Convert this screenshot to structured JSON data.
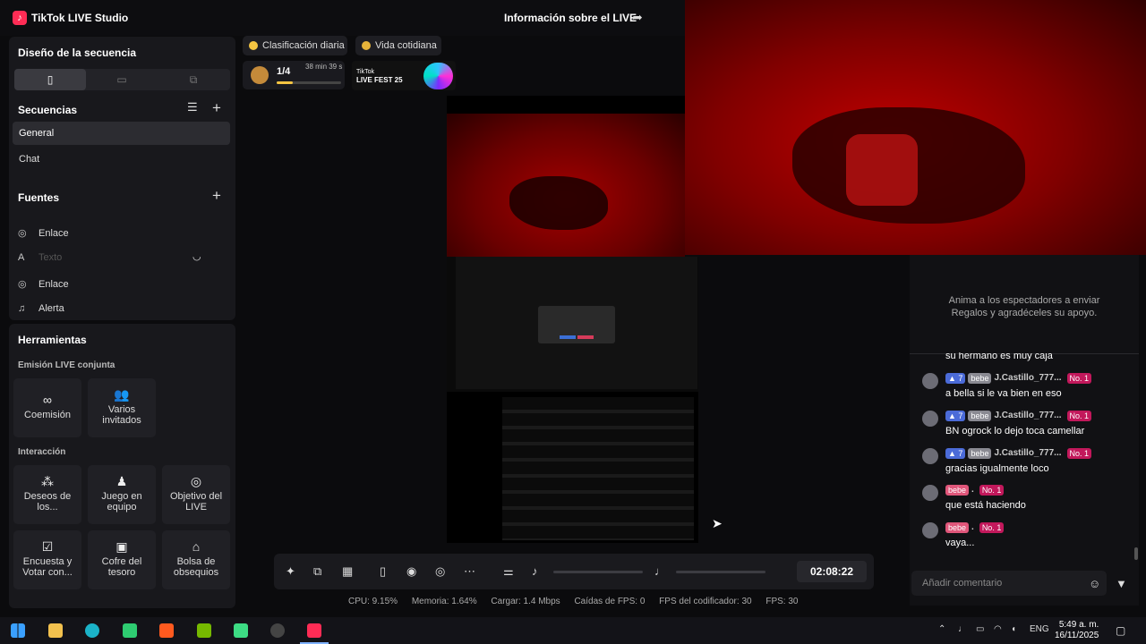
{
  "app": {
    "title": "TikTok LIVE Studio",
    "live_info": "Información sobre el LIVE"
  },
  "layout_panel": {
    "title": "Diseño de la secuencia"
  },
  "sequences": {
    "title": "Secuencias",
    "items": [
      "General",
      "Chat"
    ],
    "selected": "General"
  },
  "sources": {
    "title": "Fuentes",
    "items": [
      {
        "label": "Enlace",
        "icon": "globe-icon"
      },
      {
        "label": "Texto",
        "icon": "text-icon",
        "disabled": true
      },
      {
        "label": "Enlace",
        "icon": "globe-icon"
      },
      {
        "label": "Alerta",
        "icon": "bell-icon"
      }
    ]
  },
  "tools": {
    "title": "Herramientas",
    "joint_live": "Emisión LIVE conjunta",
    "joint_items": [
      "Coemisión",
      "Varios invitados"
    ],
    "interaction": "Interacción",
    "interaction_items": [
      "Deseos de los...",
      "Juego en equipo",
      "Objetivo del LIVE",
      "Encuesta y Votar con...",
      "Cofre del tesoro",
      "Bolsa de obsequios"
    ]
  },
  "top_pills": {
    "ranking": "Clasificación diaria",
    "category": "Vida cotidiana"
  },
  "progress": {
    "count": "1/4",
    "time": "38 min 39 s",
    "fraction": 0.25
  },
  "promo": {
    "line1": "TikTok",
    "line2": "LIVE FEST 25"
  },
  "chat": {
    "invite_text": "Anima a los espectadores a enviar Regalos y agradéceles su apoyo.",
    "clipped_message": "su hermano es muy caja",
    "messages": [
      {
        "level": "7",
        "fan": "bebe",
        "user": "J.Castillo_777...",
        "rank": "No. 1",
        "text": "a bella si le va bien en eso"
      },
      {
        "level": "7",
        "fan": "bebe",
        "user": "J.Castillo_777...",
        "rank": "No. 1",
        "text": "BN ogrock lo dejo toca camellar"
      },
      {
        "level": "7",
        "fan": "bebe",
        "user": "J.Castillo_777...",
        "rank": "No. 1",
        "text": "gracias igualmente loco"
      },
      {
        "level": "",
        "fan": "bebe",
        "user": ".",
        "rank": "No. 1",
        "text": "que está haciendo"
      },
      {
        "level": "",
        "fan": "bebe",
        "user": ".",
        "rank": "No. 1",
        "text": "vaya..."
      }
    ],
    "input_placeholder": "Añadir comentario"
  },
  "toolbar": {
    "timer": "02:08:22"
  },
  "stats": {
    "cpu": "CPU: 9.15%",
    "memory": "Memoria: 1.64%",
    "upload": "Cargar: 1.4 Mbps",
    "fps_drops": "Caídas de FPS: 0",
    "encoder_fps": "FPS del codificador: 30",
    "fps": "FPS: 30"
  },
  "taskbar": {
    "time": "5:49 a. m.",
    "date": "16/11/2025",
    "lang": "ENG"
  },
  "colors": {
    "accent": "#fe2c55",
    "level": "#4b6bd8",
    "rank": "#c2185b"
  }
}
